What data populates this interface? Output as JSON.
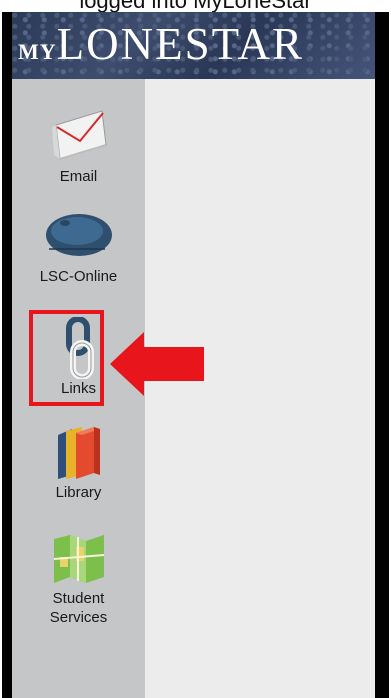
{
  "caption": {
    "text": "logged into MyLoneStar"
  },
  "header": {
    "logo_prefix": "MY",
    "logo_main": "LONESTAR"
  },
  "sidebar": {
    "items": [
      {
        "label": "Email",
        "icon": "envelope-icon"
      },
      {
        "label": "LSC-Online",
        "icon": "mouse-icon"
      },
      {
        "label": "Links",
        "icon": "chain-link-icon"
      },
      {
        "label": "Library",
        "icon": "books-icon"
      },
      {
        "label": "Student Services",
        "icon": "map-icon"
      }
    ]
  },
  "annotation": {
    "highlight_color": "#e8161c",
    "highlighted_item": "Links"
  },
  "colors": {
    "sidebar": "#c4c6c8",
    "content": "#ececed",
    "banner": "#33415f",
    "frame": "#000000"
  }
}
